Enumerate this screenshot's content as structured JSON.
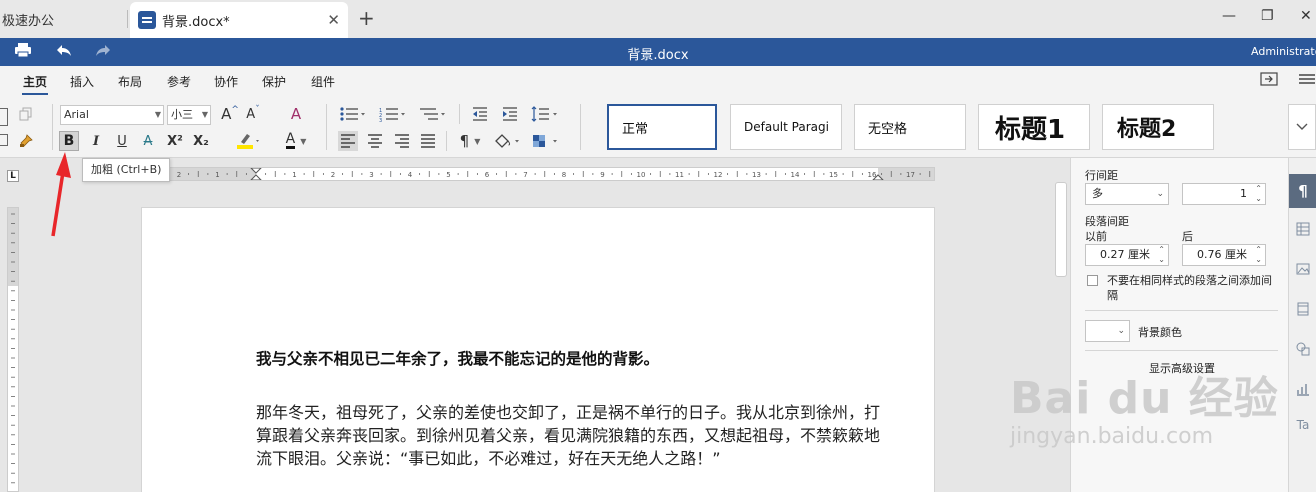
{
  "tabs": {
    "inactive_label": "极速办公",
    "active_label": "背景.docx*",
    "close": "✕",
    "new_tab": "+"
  },
  "window_controls": {
    "minimize": "—",
    "maximize": "❐",
    "close": "✕"
  },
  "titlebar": {
    "title": "背景.docx",
    "user": "Administrator"
  },
  "menu": [
    "主页",
    "插入",
    "布局",
    "参考",
    "协作",
    "保护",
    "组件"
  ],
  "ribbon": {
    "font_name": "Arial",
    "font_size": "小三",
    "bold": "B",
    "italic": "I",
    "underline": "U",
    "strike": "A",
    "superscript": "X²",
    "subscript": "X₂",
    "grow": "A",
    "shrink": "A",
    "clear_format": "A",
    "font_color": "A",
    "pilcrow": "¶"
  },
  "styles": [
    "正常",
    "Default Paragi",
    "无空格",
    "标题1",
    "标题2"
  ],
  "tooltip": "加粗 (Ctrl+B)",
  "document": {
    "heading": "我与父亲不相见已二年余了，我最不能忘记的是他的背影。",
    "paragraph": "那年冬天，祖母死了，父亲的差使也交卸了，正是祸不单行的日子。我从北京到徐州，打算跟着父亲奔丧回家。到徐州见着父亲，看见满院狼籍的东西，又想起祖母，不禁簌簌地流下眼泪。父亲说：“事已如此，不必难过，好在天无绝人之路！”"
  },
  "ruler": {
    "corner": "L"
  },
  "panel": {
    "line_spacing_label": "行间距",
    "line_spacing_type": "多",
    "line_spacing_value": "1",
    "para_spacing_label": "段落间距",
    "before_label": "以前",
    "after_label": "后",
    "before_value": "0.27 厘米",
    "after_value": "0.76 厘米",
    "no_space_same_style": "不要在相同样式的段落之间添加间隔",
    "bg_color_label": "背景颜色",
    "advanced_link": "显示高级设置"
  },
  "watermark": {
    "main": "Bai du 经验",
    "sub": "jingyan.baidu.com"
  },
  "colors": {
    "brand": "#2b579a",
    "highlight": "#ffe500",
    "font_red": "#d00000"
  }
}
